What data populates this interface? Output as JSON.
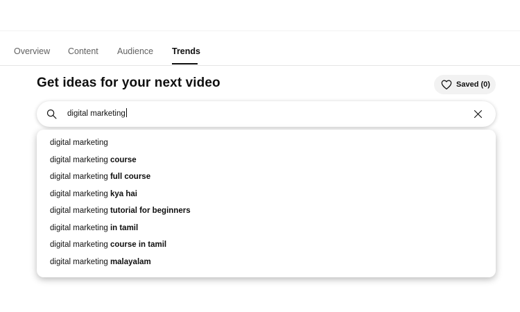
{
  "tabs": [
    {
      "label": "Overview",
      "active": false
    },
    {
      "label": "Content",
      "active": false
    },
    {
      "label": "Audience",
      "active": false
    },
    {
      "label": "Trends",
      "active": true
    }
  ],
  "header": {
    "title": "Get ideas for your next video",
    "saved_label": "Saved (0)"
  },
  "search": {
    "value": "digital marketing",
    "search_icon": "search-icon",
    "clear_icon": "close-icon"
  },
  "suggestions": [
    {
      "prefix": "digital marketing",
      "completion": ""
    },
    {
      "prefix": "digital marketing ",
      "completion": "course"
    },
    {
      "prefix": "digital marketing ",
      "completion": "full course"
    },
    {
      "prefix": "digital marketing ",
      "completion": "kya hai"
    },
    {
      "prefix": "digital marketing ",
      "completion": "tutorial for beginners"
    },
    {
      "prefix": "digital marketing ",
      "completion": "in tamil"
    },
    {
      "prefix": "digital marketing ",
      "completion": "course in tamil"
    },
    {
      "prefix": "digital marketing ",
      "completion": "malayalam"
    }
  ],
  "colors": {
    "text_primary": "#0f0f0f",
    "text_secondary": "#606060",
    "chip_background": "#f2f2f2"
  }
}
